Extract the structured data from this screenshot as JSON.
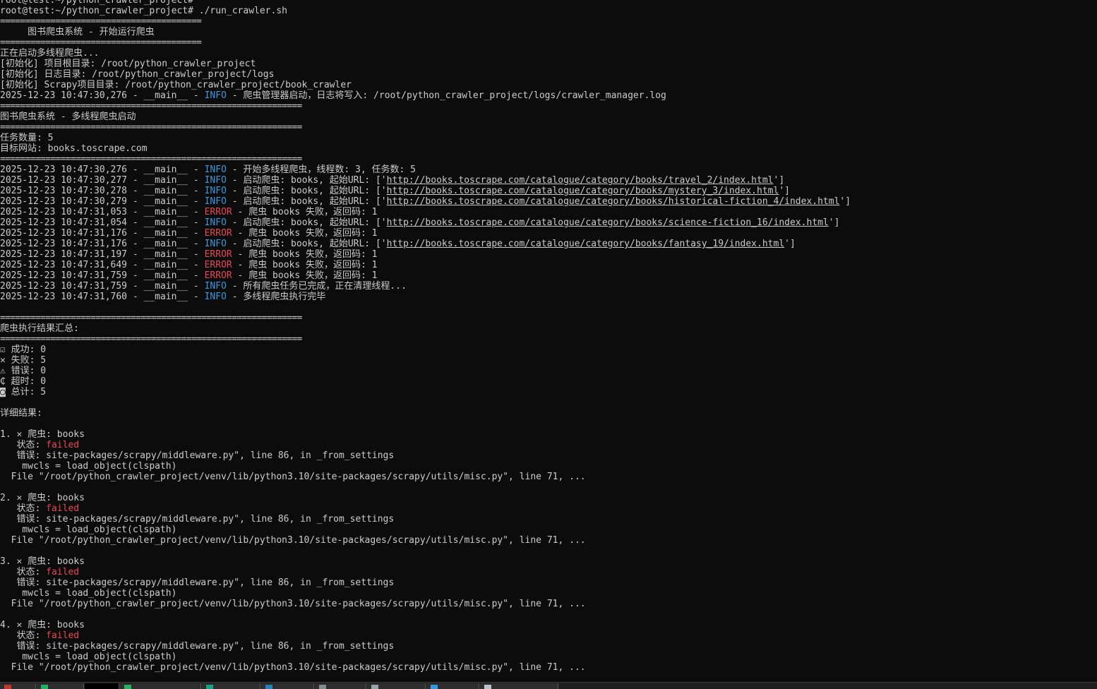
{
  "terminal": {
    "lines": [
      [
        {
          "t": "root@test:~/python_crawler_project#"
        }
      ],
      [
        {
          "t": "root@test:~/python_crawler_project# ./run_crawler.sh"
        }
      ],
      [
        {
          "t": "========================================",
          "c": "sep"
        }
      ],
      [
        {
          "t": "     图书爬虫系统 - 开始运行爬虫"
        }
      ],
      [
        {
          "t": "========================================",
          "c": "sep"
        }
      ],
      [
        {
          "t": "正在启动多线程爬虫..."
        }
      ],
      [
        {
          "t": "[初始化] 项目根目录: /root/python_crawler_project"
        }
      ],
      [
        {
          "t": "[初始化] 日志目录: /root/python_crawler_project/logs"
        }
      ],
      [
        {
          "t": "[初始化] Scrapy项目目录: /root/python_crawler_project/book_crawler"
        }
      ],
      [
        {
          "t": "2025-12-23 10:47:30,276 - __main__ - "
        },
        {
          "t": "INFO",
          "c": "info"
        },
        {
          "t": " - 爬虫管理器启动，日志将写入: /root/python_crawler_project/logs/crawler_manager.log"
        }
      ],
      [
        {
          "t": "============================================================",
          "c": "sep"
        }
      ],
      [
        {
          "t": "图书爬虫系统 - 多线程爬虫启动"
        }
      ],
      [
        {
          "t": "============================================================",
          "c": "sep"
        }
      ],
      [
        {
          "t": "任务数量: 5"
        }
      ],
      [
        {
          "t": "目标网站: books.toscrape.com"
        }
      ],
      [
        {
          "t": "============================================================",
          "c": "sep"
        }
      ],
      [
        {
          "t": "2025-12-23 10:47:30,276 - __main__ - "
        },
        {
          "t": "INFO",
          "c": "info"
        },
        {
          "t": " - 开始多线程爬虫，线程数: 3, 任务数: 5"
        }
      ],
      [
        {
          "t": "2025-12-23 10:47:30,277 - __main__ - "
        },
        {
          "t": "INFO",
          "c": "info"
        },
        {
          "t": " - 启动爬虫: books, 起始URL: ['"
        },
        {
          "t": "http://books.toscrape.com/catalogue/category/books/travel_2/index.html",
          "c": "url"
        },
        {
          "t": "']"
        }
      ],
      [
        {
          "t": "2025-12-23 10:47:30,278 - __main__ - "
        },
        {
          "t": "INFO",
          "c": "info"
        },
        {
          "t": " - 启动爬虫: books, 起始URL: ['"
        },
        {
          "t": "http://books.toscrape.com/catalogue/category/books/mystery_3/index.html",
          "c": "url"
        },
        {
          "t": "']"
        }
      ],
      [
        {
          "t": "2025-12-23 10:47:30,279 - __main__ - "
        },
        {
          "t": "INFO",
          "c": "info"
        },
        {
          "t": " - 启动爬虫: books, 起始URL: ['"
        },
        {
          "t": "http://books.toscrape.com/catalogue/category/books/historical-fiction_4/index.html",
          "c": "url"
        },
        {
          "t": "']"
        }
      ],
      [
        {
          "t": "2025-12-23 10:47:31,053 - __main__ - "
        },
        {
          "t": "ERROR",
          "c": "error"
        },
        {
          "t": " - 爬虫 books 失败，返回码: 1"
        }
      ],
      [
        {
          "t": "2025-12-23 10:47:31,054 - __main__ - "
        },
        {
          "t": "INFO",
          "c": "info"
        },
        {
          "t": " - 启动爬虫: books, 起始URL: ['"
        },
        {
          "t": "http://books.toscrape.com/catalogue/category/books/science-fiction_16/index.html",
          "c": "url"
        },
        {
          "t": "']"
        }
      ],
      [
        {
          "t": "2025-12-23 10:47:31,176 - __main__ - "
        },
        {
          "t": "ERROR",
          "c": "error"
        },
        {
          "t": " - 爬虫 books 失败，返回码: 1"
        }
      ],
      [
        {
          "t": "2025-12-23 10:47:31,176 - __main__ - "
        },
        {
          "t": "INFO",
          "c": "info"
        },
        {
          "t": " - 启动爬虫: books, 起始URL: ['"
        },
        {
          "t": "http://books.toscrape.com/catalogue/category/books/fantasy_19/index.html",
          "c": "url"
        },
        {
          "t": "']"
        }
      ],
      [
        {
          "t": "2025-12-23 10:47:31,197 - __main__ - "
        },
        {
          "t": "ERROR",
          "c": "error"
        },
        {
          "t": " - 爬虫 books 失败，返回码: 1"
        }
      ],
      [
        {
          "t": "2025-12-23 10:47:31,649 - __main__ - "
        },
        {
          "t": "ERROR",
          "c": "error"
        },
        {
          "t": " - 爬虫 books 失败，返回码: 1"
        }
      ],
      [
        {
          "t": "2025-12-23 10:47:31,759 - __main__ - "
        },
        {
          "t": "ERROR",
          "c": "error"
        },
        {
          "t": " - 爬虫 books 失败，返回码: 1"
        }
      ],
      [
        {
          "t": "2025-12-23 10:47:31,759 - __main__ - "
        },
        {
          "t": "INFO",
          "c": "info"
        },
        {
          "t": " - 所有爬虫任务已完成，正在清理线程..."
        }
      ],
      [
        {
          "t": "2025-12-23 10:47:31,760 - __main__ - "
        },
        {
          "t": "INFO",
          "c": "info"
        },
        {
          "t": " - 多线程爬虫执行完毕"
        }
      ],
      [
        {
          "t": ""
        }
      ],
      [
        {
          "t": "============================================================",
          "c": "sep"
        }
      ],
      [
        {
          "t": "爬虫执行结果汇总:"
        }
      ],
      [
        {
          "t": "============================================================",
          "c": "sep"
        }
      ],
      [
        {
          "t": "☑ 成功: 0"
        }
      ],
      [
        {
          "t": "✕ 失败: 5"
        }
      ],
      [
        {
          "t": "⚠ 错误: 0"
        }
      ],
      [
        {
          "t": "₵ 超时: 0"
        }
      ],
      [
        {
          "t": "◙ 总计: 5"
        }
      ],
      [
        {
          "t": ""
        }
      ],
      [
        {
          "t": "详细结果:"
        }
      ],
      [
        {
          "t": ""
        }
      ],
      [
        {
          "t": "1. ✕ 爬虫: books"
        }
      ],
      [
        {
          "t": "   状态: "
        },
        {
          "t": "failed",
          "c": "failed"
        }
      ],
      [
        {
          "t": "   错误: site-packages/scrapy/middleware.py\", line 86, in _from_settings"
        }
      ],
      [
        {
          "t": "    mwcls = load_object(clspath)"
        }
      ],
      [
        {
          "t": "  File \"/root/python_crawler_project/venv/lib/python3.10/site-packages/scrapy/utils/misc.py\", line 71, ..."
        }
      ],
      [
        {
          "t": ""
        }
      ],
      [
        {
          "t": "2. ✕ 爬虫: books"
        }
      ],
      [
        {
          "t": "   状态: "
        },
        {
          "t": "failed",
          "c": "failed"
        }
      ],
      [
        {
          "t": "   错误: site-packages/scrapy/middleware.py\", line 86, in _from_settings"
        }
      ],
      [
        {
          "t": "    mwcls = load_object(clspath)"
        }
      ],
      [
        {
          "t": "  File \"/root/python_crawler_project/venv/lib/python3.10/site-packages/scrapy/utils/misc.py\", line 71, ..."
        }
      ],
      [
        {
          "t": ""
        }
      ],
      [
        {
          "t": "3. ✕ 爬虫: books"
        }
      ],
      [
        {
          "t": "   状态: "
        },
        {
          "t": "failed",
          "c": "failed"
        }
      ],
      [
        {
          "t": "   错误: site-packages/scrapy/middleware.py\", line 86, in _from_settings"
        }
      ],
      [
        {
          "t": "    mwcls = load_object(clspath)"
        }
      ],
      [
        {
          "t": "  File \"/root/python_crawler_project/venv/lib/python3.10/site-packages/scrapy/utils/misc.py\", line 71, ..."
        }
      ],
      [
        {
          "t": ""
        }
      ],
      [
        {
          "t": "4. ✕ 爬虫: books"
        }
      ],
      [
        {
          "t": "   状态: "
        },
        {
          "t": "failed",
          "c": "failed"
        }
      ],
      [
        {
          "t": "   错误: site-packages/scrapy/middleware.py\", line 86, in _from_settings"
        }
      ],
      [
        {
          "t": "    mwcls = load_object(clspath)"
        }
      ],
      [
        {
          "t": "  File \"/root/python_crawler_project/venv/lib/python3.10/site-packages/scrapy/utils/misc.py\", line 71, ..."
        }
      ]
    ]
  },
  "taskbar": {
    "items": [
      {
        "icon": "app-icon",
        "color": "#c0392b",
        "active": false
      },
      {
        "icon": "app-icon",
        "color": "#27ae60",
        "active": false
      },
      {
        "icon": "terminal-icon",
        "color": "#000000",
        "active": true
      },
      {
        "icon": "app-icon",
        "color": "#27ae60",
        "active": false
      },
      {
        "icon": "app-icon",
        "color": "#16a085",
        "active": false
      },
      {
        "icon": "app-icon",
        "color": "#2980b9",
        "active": false
      },
      {
        "icon": "app-icon",
        "color": "#7f8c8d",
        "active": false
      },
      {
        "icon": "app-icon",
        "color": "#95a5a6",
        "active": false
      },
      {
        "icon": "app-icon",
        "color": "#3498db",
        "active": false
      },
      {
        "icon": "app-icon",
        "color": "#bdc3c7",
        "active": false
      }
    ]
  },
  "colors": {
    "background": "#0c0c0c",
    "text": "#cccccc",
    "info": "#3a96dd",
    "error": "#e74856"
  }
}
